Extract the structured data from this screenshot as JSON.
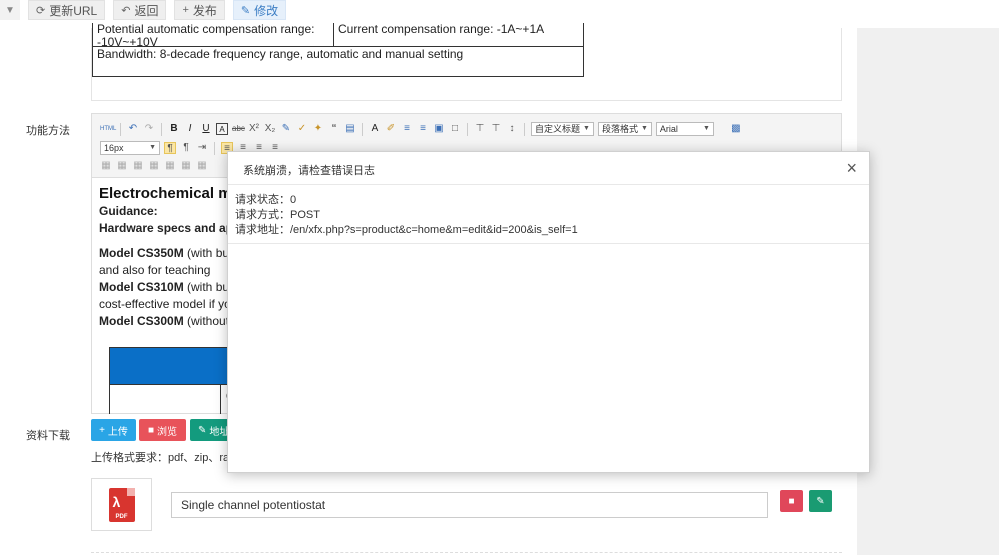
{
  "toolbar": {
    "collapse_icon": "chevron-double-down-icon",
    "buttons": [
      {
        "label": "更新URL",
        "icon": "refresh-icon"
      },
      {
        "label": "返回",
        "icon": "reply-icon"
      },
      {
        "label": "发布",
        "icon": "plus-icon"
      },
      {
        "label": "修改",
        "icon": "edit-icon"
      }
    ]
  },
  "spec_table": {
    "row1_col1": "Potential automatic compensation range:",
    "row1_col1b": "-10V~+10V",
    "row1_col2": "Current compensation range: -1A~+1A",
    "row2": "Bandwidth: 8-decade frequency range, automatic and manual setting"
  },
  "sections": {
    "method_label": "功能方法",
    "download_label": "资料下载"
  },
  "editor": {
    "font_size": "16px",
    "custom_title": "自定义标题",
    "paragraph_format": "段落格式",
    "font_family": "Arial",
    "code_language": "代码语言",
    "content": {
      "heading": "Electrochemical me",
      "guidance": "Guidance:",
      "hardware": "Hardware specs and ap",
      "model1": "Model CS350M",
      "model1_rest": " (with bu",
      "model1_line2": "and also for teaching",
      "model2": "Model CS310M",
      "model2_rest": " (with bu",
      "model2_line2": "cost-effective model if yo",
      "model3": "Model CS300M",
      "model3_rest": " (without",
      "table_cell_char": "C"
    }
  },
  "downloads": {
    "upload_button": "上传",
    "browse_button": "浏览",
    "address_button": "地址",
    "format_note": "上传格式要求：pdf、zip、ra",
    "file_name": "Single channel potentiostat",
    "file_type_label": "PDF"
  },
  "modal": {
    "title": "系统崩溃，请检查错误日志",
    "close": "×",
    "status_line": "请求状态：0",
    "method_line": "请求方式：POST",
    "url_line": "请求地址：/en/xfx.php?s=product&c=home&m=edit&id=200&is_self=1"
  },
  "colors": {
    "upload": "#2aa5e6",
    "browse": "#e8535a",
    "address": "#139b7e",
    "delete": "#e0475a",
    "edit": "#1a9b72",
    "editor_table_header": "#0a6fc7"
  }
}
